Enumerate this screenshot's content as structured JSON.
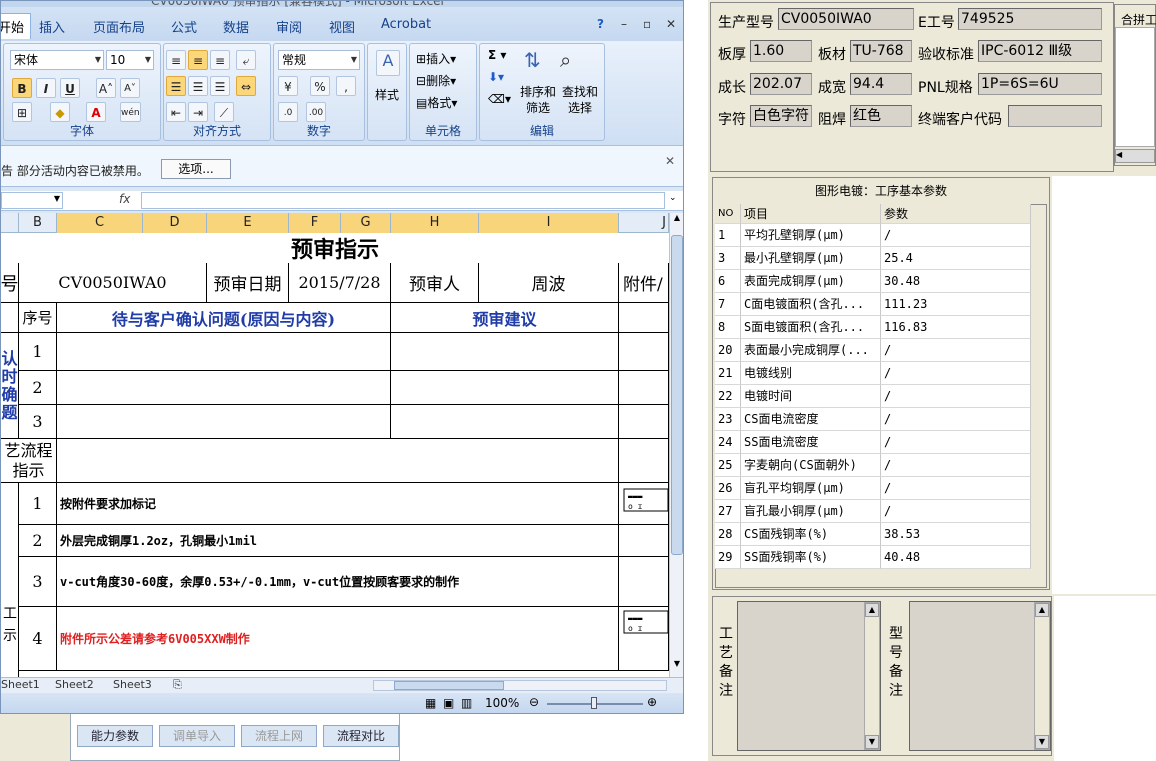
{
  "excel": {
    "title": "CV0050IWA0 预审指示 [兼容模式] - Microsoft Excel",
    "tabs": [
      "开始",
      "插入",
      "页面布局",
      "公式",
      "数据",
      "审阅",
      "视图",
      "Acrobat"
    ],
    "ribbon": {
      "font_name": "宋体",
      "font_size": "10",
      "number_format": "常规",
      "style_label": "样式",
      "insert_label": "插入",
      "delete_label": "删除",
      "format_label": "格式",
      "sort_label": "排序和筛选",
      "find_label": "查找和选择",
      "groups": {
        "font": "字体",
        "align": "对齐方式",
        "number": "数字",
        "cells": "单元格",
        "edit": "编辑"
      }
    },
    "message_bar": {
      "text": "告  部分活动内容已被禁用。",
      "options_button": "选项..."
    },
    "formula_bar": {
      "fx": "fx"
    },
    "column_headers": [
      "B",
      "C",
      "D",
      "E",
      "F",
      "G",
      "H",
      "I",
      "J"
    ],
    "sheet": {
      "title": "预审指示",
      "part_number_label": "号",
      "part_number": "CV0050IWA0",
      "date_label": "预审日期",
      "date": "2015/7/28",
      "reviewer_label": "预审人",
      "reviewer": "周波",
      "attachment_label": "附件/",
      "seq_header": "序号",
      "issue_header": "待与客户确认问题(原因与内容)",
      "suggestion_header": "预审建议",
      "left_confirm_label": "认时确题",
      "rows_confirm": [
        "1",
        "2",
        "3"
      ],
      "process_label": "艺流程指示",
      "instructions": [
        {
          "no": "1",
          "text": "按附件要求加标记",
          "color": "#000000"
        },
        {
          "no": "2",
          "text": "外层完成铜厚1.2oz，孔铜最小1mil",
          "color": "#000000"
        },
        {
          "no": "3",
          "text": "v-cut角度30-60度，余厚0.53+/-0.1mm，v-cut位置按顾客要求的制作",
          "color": "#000000"
        },
        {
          "no": "4",
          "text": "附件所示公差请参考6V005XXW制作",
          "color": "#e02020"
        }
      ],
      "left_side_fragments": [
        "工",
        "示"
      ]
    },
    "sheet_tabs": [
      "Sheet1",
      "Sheet2",
      "Sheet3"
    ],
    "zoom": "100%"
  },
  "back_app": {
    "buttons": [
      {
        "label": "能力参数",
        "enabled": true
      },
      {
        "label": "调单导入",
        "enabled": false
      },
      {
        "label": "流程上网",
        "enabled": false
      },
      {
        "label": "流程对比",
        "enabled": true
      }
    ]
  },
  "right_panel": {
    "fields": {
      "product_model_label": "生产型号",
      "product_model": "CV0050IWA0",
      "e_no_label": "E工号",
      "e_no": "749525",
      "board_thickness_label": "板厚",
      "board_thickness": "1.60",
      "material_label": "板材",
      "material": "TU-768",
      "acceptance_label": "验收标准",
      "acceptance": "IPC-6012 Ⅲ级",
      "length_label": "成长",
      "length": "202.07",
      "width_label": "成宽",
      "width": "94.4",
      "pnl_label": "PNL规格",
      "pnl": "1P=6S=6U",
      "legend_label": "字符",
      "legend": "白色字符",
      "solder_mask_label": "阻焊",
      "solder_mask": "红色",
      "end_customer_label": "终端客户代码",
      "end_customer": ""
    },
    "merge_label": "合拼工",
    "param_panel": {
      "title": "图形电镀：工序基本参数",
      "headers": [
        "NO",
        "项目",
        "参数"
      ],
      "rows": [
        {
          "no": "1",
          "item": "平均孔壁铜厚(μm)",
          "value": "/"
        },
        {
          "no": "3",
          "item": "最小孔壁铜厚(μm)",
          "value": "25.4"
        },
        {
          "no": "6",
          "item": "表面完成铜厚(μm)",
          "value": "30.48"
        },
        {
          "no": "7",
          "item": "C面电镀面积(含孔...",
          "value": "111.23"
        },
        {
          "no": "8",
          "item": "S面电镀面积(含孔...",
          "value": "116.83"
        },
        {
          "no": "20",
          "item": "表面最小完成铜厚(...",
          "value": "/"
        },
        {
          "no": "21",
          "item": "电镀线别",
          "value": "/"
        },
        {
          "no": "22",
          "item": "电镀时间",
          "value": "/"
        },
        {
          "no": "23",
          "item": "CS面电流密度",
          "value": "/"
        },
        {
          "no": "24",
          "item": "SS面电流密度",
          "value": "/"
        },
        {
          "no": "25",
          "item": "字麦朝向(CS面朝外)",
          "value": "/"
        },
        {
          "no": "26",
          "item": "盲孔平均铜厚(μm)",
          "value": "/"
        },
        {
          "no": "27",
          "item": "盲孔最小铜厚(μm)",
          "value": "/"
        },
        {
          "no": "28",
          "item": "CS面残铜率(%)",
          "value": "38.53"
        },
        {
          "no": "29",
          "item": "SS面残铜率(%)",
          "value": "40.48"
        }
      ]
    },
    "process_note_label": "工艺备注",
    "model_note_label": "型号备注"
  }
}
